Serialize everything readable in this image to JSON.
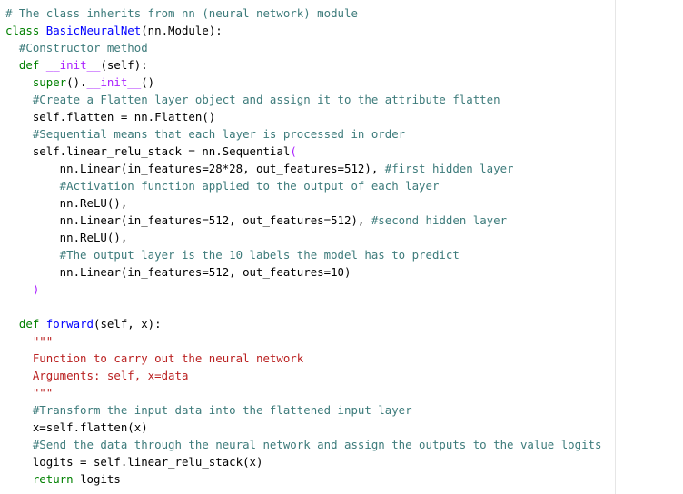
{
  "editor": {
    "lines": [
      [
        {
          "t": "# The class inherits from nn (neural network) module",
          "c": "cm"
        }
      ],
      [
        {
          "t": "class ",
          "c": "kw"
        },
        {
          "t": "BasicNeuralNet",
          "c": "cls"
        },
        {
          "t": "(nn.",
          "c": ""
        },
        {
          "t": "Module",
          "c": ""
        },
        {
          "t": "):",
          "c": ""
        }
      ],
      [
        {
          "t": "  #Constructor method",
          "c": "cm"
        }
      ],
      [
        {
          "t": "  ",
          "c": ""
        },
        {
          "t": "def ",
          "c": "kw"
        },
        {
          "t": "__init__",
          "c": "sp"
        },
        {
          "t": "(self):",
          "c": ""
        }
      ],
      [
        {
          "t": "    super",
          "c": "kw"
        },
        {
          "t": "().",
          "c": ""
        },
        {
          "t": "__init__",
          "c": "sp"
        },
        {
          "t": "()",
          "c": ""
        }
      ],
      [
        {
          "t": "    #Create a Flatten layer object and assign it to the attribute flatten",
          "c": "cm"
        }
      ],
      [
        {
          "t": "    self.flatten = nn.Flatten()",
          "c": ""
        }
      ],
      [
        {
          "t": "    #Sequential means that each layer is processed in order",
          "c": "cm"
        }
      ],
      [
        {
          "t": "    self.linear_relu_stack = nn.Sequential",
          "c": ""
        },
        {
          "t": "(",
          "c": "op"
        }
      ],
      [
        {
          "t": "        nn.Linear(in_features=28*28, out_features=512), ",
          "c": ""
        },
        {
          "t": "#first hidden layer",
          "c": "cm"
        }
      ],
      [
        {
          "t": "        #Activation function applied to the output of each layer",
          "c": "cm"
        }
      ],
      [
        {
          "t": "        nn.ReLU(),",
          "c": ""
        }
      ],
      [
        {
          "t": "        nn.Linear(in_features=512, out_features=512), ",
          "c": ""
        },
        {
          "t": "#second hidden layer",
          "c": "cm"
        }
      ],
      [
        {
          "t": "        nn.ReLU(),",
          "c": ""
        }
      ],
      [
        {
          "t": "        #The output layer is the 10 labels the model has to predict",
          "c": "cm"
        }
      ],
      [
        {
          "t": "        nn.Linear(in_features=512, out_features=10)",
          "c": ""
        }
      ],
      [
        {
          "t": "    )",
          "c": "op"
        }
      ],
      [
        {
          "t": "",
          "c": ""
        }
      ],
      [
        {
          "t": "  ",
          "c": ""
        },
        {
          "t": "def ",
          "c": "kw"
        },
        {
          "t": "forward",
          "c": "fn"
        },
        {
          "t": "(self, x):",
          "c": ""
        }
      ],
      [
        {
          "t": "    \"\"\"",
          "c": "str"
        }
      ],
      [
        {
          "t": "    Function to carry out the neural network",
          "c": "str"
        }
      ],
      [
        {
          "t": "    Arguments: self, x=data",
          "c": "str"
        }
      ],
      [
        {
          "t": "    \"\"\"",
          "c": "str"
        }
      ],
      [
        {
          "t": "    #Transform the input data into the flattened input layer",
          "c": "cm"
        }
      ],
      [
        {
          "t": "    x=self.flatten(x)",
          "c": ""
        }
      ],
      [
        {
          "t": "    #Send the data through the neural network and assign the outputs to the value logits",
          "c": "cm"
        }
      ],
      [
        {
          "t": "    logits = self.linear_relu_stack(x)",
          "c": ""
        }
      ],
      [
        {
          "t": "    ",
          "c": ""
        },
        {
          "t": "return ",
          "c": "kw"
        },
        {
          "t": "logits",
          "c": ""
        }
      ]
    ]
  }
}
